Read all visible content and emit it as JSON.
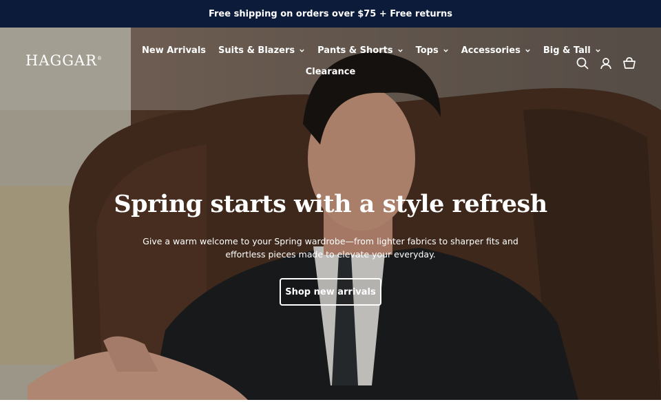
{
  "announcement": {
    "text": "Free shipping on orders over $75 + Free returns"
  },
  "header": {
    "logo": "HAGGAR",
    "logo_mark": "®",
    "nav": [
      {
        "label": "New Arrivals",
        "has_dropdown": false
      },
      {
        "label": "Suits & Blazers",
        "has_dropdown": true
      },
      {
        "label": "Pants & Shorts",
        "has_dropdown": true
      },
      {
        "label": "Tops",
        "has_dropdown": true
      },
      {
        "label": "Accessories",
        "has_dropdown": true
      },
      {
        "label": "Big & Tall",
        "has_dropdown": true
      },
      {
        "label": "Clearance",
        "has_dropdown": false
      }
    ],
    "icons": [
      "search-icon",
      "account-icon",
      "cart-icon"
    ]
  },
  "hero": {
    "title": "Spring starts with a style refresh",
    "text": "Give a warm welcome to your Spring wardrobe—from lighter fabrics to sharper fits and effortless pieces made to elevate your everyday.",
    "cta_label": "Shop new arrivals"
  },
  "colors": {
    "announcement_bg": "#0c1b3a",
    "text_on_hero": "#ffffff"
  }
}
